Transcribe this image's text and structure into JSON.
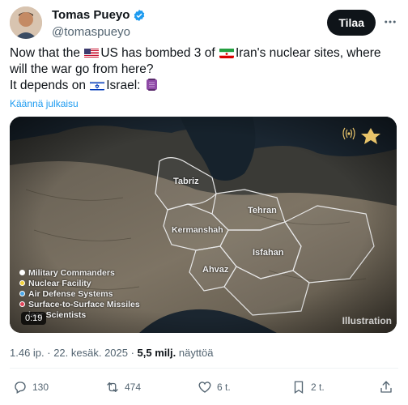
{
  "author": {
    "name": "Tomas Pueyo",
    "handle": "@tomaspueyo",
    "verified": true
  },
  "follow_label": "Tilaa",
  "tweet": {
    "part1": "Now that the ",
    "part2": "US has bombed 3 of ",
    "part3": "Iran's nuclear sites, where will the war go from here?",
    "part4": "It depends on ",
    "part5": "Israel: "
  },
  "translate_label": "Käännä julkaisu",
  "media": {
    "cities": [
      "Tabriz",
      "Tehran",
      "Kermanshah",
      "Isfahan",
      "Ahvaz"
    ],
    "legend": [
      {
        "label": "Military Commanders",
        "color": "#ffffff"
      },
      {
        "label": "Nuclear Facility",
        "color": "#f2d03b"
      },
      {
        "label": "Air Defense Systems",
        "color": "#4aa7e8"
      },
      {
        "label": "Surface-to-Surface Missiles",
        "color": "#e0455a"
      },
      {
        "label": "lear Scientists",
        "color": "#ffffff"
      }
    ],
    "timestamp": "0:19",
    "watermark": "Illustration"
  },
  "meta": {
    "time": "1.46 ip. · 22. kesäk. 2025 · ",
    "views": "5,5 milj.",
    "views_suffix": " näyttöä"
  },
  "actions": {
    "replies": "130",
    "reposts": "474",
    "likes": "6 t.",
    "bookmarks": "2 t."
  }
}
